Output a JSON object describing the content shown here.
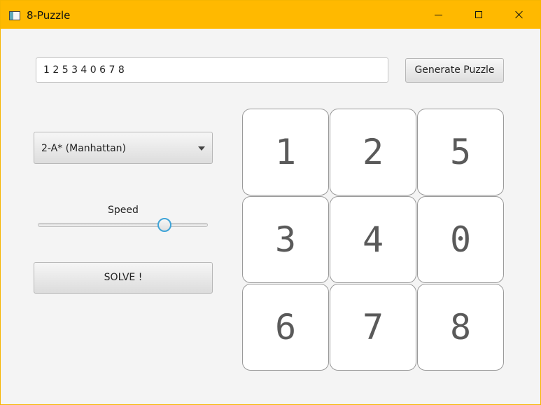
{
  "window": {
    "title": "8-Puzzle"
  },
  "puzzle_input": {
    "value": "1 2 5 3 4 0 6 7 8"
  },
  "buttons": {
    "generate": "Generate Puzzle",
    "solve": "SOLVE !"
  },
  "algorithm": {
    "selected": "2-A* (Manhattan)"
  },
  "speed": {
    "label": "Speed",
    "level": 0.75
  },
  "board": {
    "tiles": [
      "1",
      "2",
      "5",
      "3",
      "4",
      "0",
      "6",
      "7",
      "8"
    ]
  },
  "colors": {
    "titlebar": "#ffb900",
    "window_background": "#f4f4f4",
    "tile_background": "#ffffff",
    "tile_text": "#5a5a5a",
    "slider_accent": "#3fa4d8"
  },
  "icons": {
    "app": "app-window-icon",
    "minimize": "minimize-icon",
    "maximize": "maximize-icon",
    "close": "close-icon",
    "dropdown": "chevron-down-icon"
  }
}
